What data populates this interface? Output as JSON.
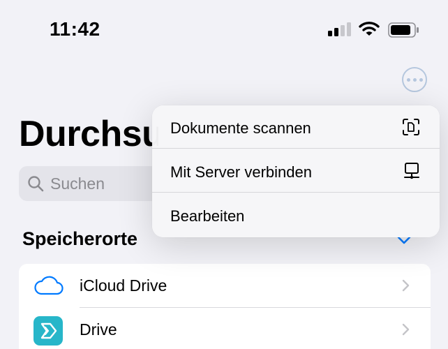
{
  "status_bar": {
    "time": "11:42",
    "icons": [
      "cellular-signal-icon",
      "wifi-icon",
      "battery-icon"
    ]
  },
  "header": {
    "title": "Durchsuchen",
    "more_icon": "ellipsis-circle-icon"
  },
  "search": {
    "placeholder": "Suchen",
    "icon": "magnifying-glass-icon"
  },
  "locations": {
    "header": "Speicherorte",
    "items": [
      {
        "label": "iCloud Drive",
        "icon": "cloud-icon"
      },
      {
        "label": "Drive",
        "icon": "drive-app-icon"
      }
    ]
  },
  "context_menu": {
    "items": [
      {
        "label": "Dokumente scannen",
        "icon": "document-scan-icon"
      },
      {
        "label": "Mit Server verbinden",
        "icon": "server-icon"
      },
      {
        "label": "Bearbeiten"
      }
    ]
  },
  "colors": {
    "accent": "#007aff",
    "background": "#f2f2f7",
    "drive_icon": "#27b6c9"
  }
}
